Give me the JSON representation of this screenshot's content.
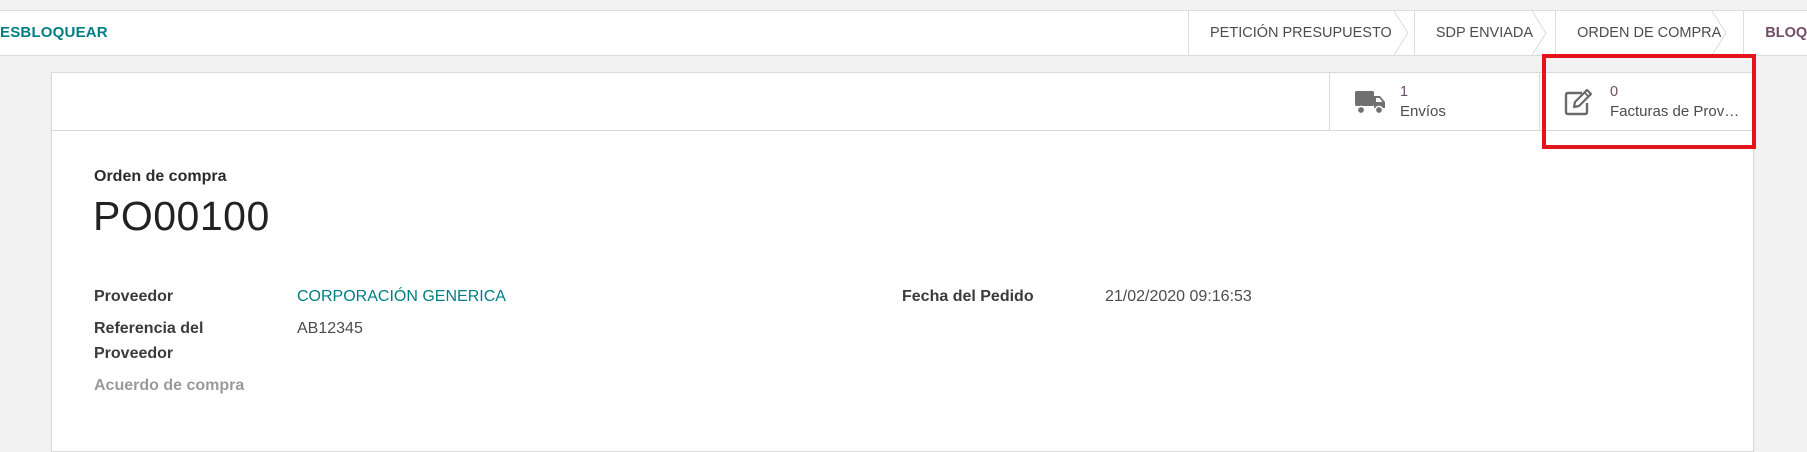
{
  "statusbar": {
    "unlock_label": "ESBLOQUEAR",
    "stages": [
      {
        "label": "PETICIÓN PRESUPUESTO",
        "active": false
      },
      {
        "label": "SDP ENVIADA",
        "active": false
      },
      {
        "label": "ORDEN DE COMPRA",
        "active": false
      },
      {
        "label": "BLOQUEA",
        "active": true
      }
    ]
  },
  "smart_buttons": {
    "shipments": {
      "value": "1",
      "label": "Envíos",
      "icon": "truck-icon"
    },
    "vendor_bills": {
      "value": "0",
      "label": "Facturas de Prov…",
      "icon": "pencil-square-icon"
    }
  },
  "document": {
    "subtitle": "Orden de compra",
    "title": "PO00100"
  },
  "fields": {
    "vendor_label": "Proveedor",
    "vendor_value": "CORPORACIÓN GENERICA",
    "vendor_ref_label_line1": "Referencia del",
    "vendor_ref_label_line2": "Proveedor",
    "vendor_ref_value": "AB12345",
    "agreement_label": "Acuerdo de compra",
    "order_date_label": "Fecha del Pedido",
    "order_date_value": "21/02/2020 09:16:53"
  },
  "colors": {
    "primary_link": "#017e84",
    "brand": "#714b67",
    "highlight": "#e3141c"
  }
}
